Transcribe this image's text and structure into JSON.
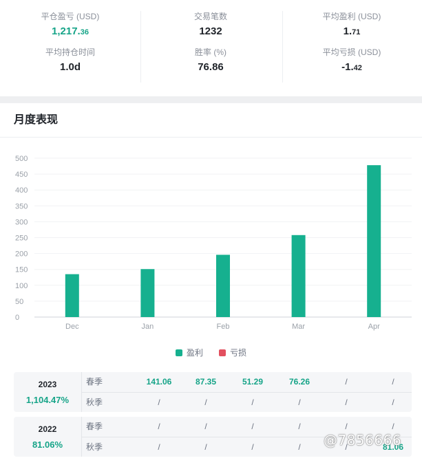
{
  "stats": {
    "avg_pnl": {
      "label": "平仓盈亏 (USD)",
      "main": "1,217.",
      "dec": "36"
    },
    "trade_count": {
      "label": "交易笔数",
      "value": "1232"
    },
    "avg_profit": {
      "label": "平均盈利 (USD)",
      "main": "1.",
      "dec": "71"
    },
    "avg_hold": {
      "label": "平均持仓时间",
      "value": "1.0d"
    },
    "win_rate": {
      "label": "胜率 (%)",
      "value": "76.86"
    },
    "avg_loss": {
      "label": "平均亏损 (USD)",
      "main": "-1.",
      "dec": "42"
    }
  },
  "section": {
    "title": "月度表现"
  },
  "chart_data": {
    "type": "bar",
    "categories": [
      "Dec",
      "Jan",
      "Feb",
      "Mar",
      "Apr"
    ],
    "series": [
      {
        "name": "盈利",
        "values": [
          135,
          151,
          196,
          258,
          478
        ],
        "color": "#16b08f"
      },
      {
        "name": "亏损",
        "values": [
          0,
          0,
          0,
          0,
          0
        ],
        "color": "#e2505f"
      }
    ],
    "yticks": [
      "0",
      "50",
      "100",
      "150",
      "200",
      "250",
      "300",
      "350",
      "400",
      "450",
      "500"
    ],
    "ylim": [
      0,
      500
    ],
    "grid": true,
    "legend": "bottom-center"
  },
  "years": [
    {
      "year": "2023",
      "total": "1,104.47%",
      "rows": [
        {
          "season": "春季",
          "values": [
            "141.06",
            "87.35",
            "51.29",
            "76.26",
            "/",
            "/"
          ],
          "highlight": [
            true,
            true,
            true,
            true,
            false,
            false
          ]
        },
        {
          "season": "秋季",
          "values": [
            "/",
            "/",
            "/",
            "/",
            "/",
            "/"
          ],
          "highlight": [
            false,
            false,
            false,
            false,
            false,
            false
          ]
        }
      ]
    },
    {
      "year": "2022",
      "total": "81.06%",
      "rows": [
        {
          "season": "春季",
          "values": [
            "/",
            "/",
            "/",
            "/",
            "/",
            "/"
          ],
          "highlight": [
            false,
            false,
            false,
            false,
            false,
            false
          ]
        },
        {
          "season": "秋季",
          "values": [
            "/",
            "/",
            "/",
            "/",
            "/",
            "81.06"
          ],
          "highlight": [
            false,
            false,
            false,
            false,
            false,
            true
          ]
        }
      ]
    }
  ],
  "watermark": "@7856666"
}
